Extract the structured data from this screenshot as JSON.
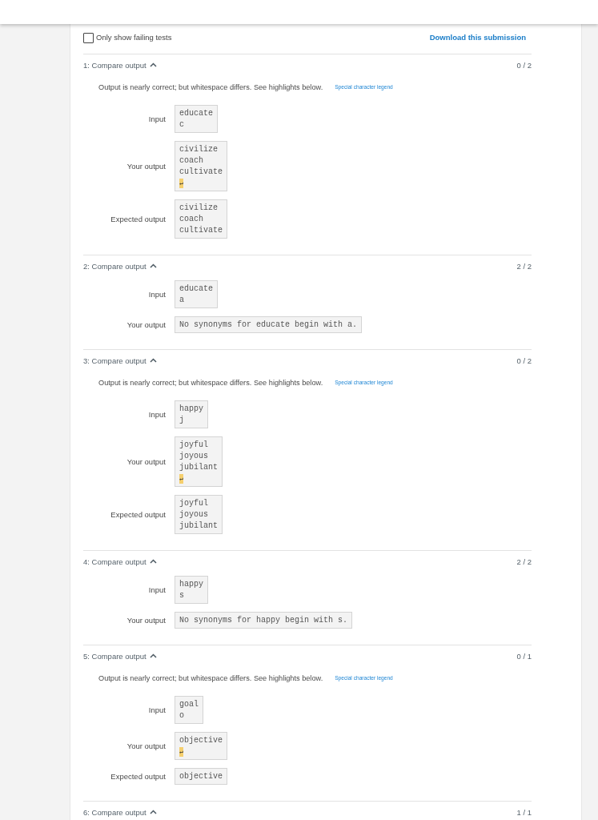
{
  "filter": {
    "label": "Only show failing tests",
    "checked": false
  },
  "download_link": "Download this submission",
  "tests": [
    {
      "title": "1: Compare output",
      "expanded": true,
      "score": "0 / 2",
      "message": {
        "text": "Output is nearly correct; but whitespace differs. See highlights below.",
        "link": "Special character legend"
      },
      "rows": [
        {
          "label": "Input",
          "lines": [
            "educate",
            "c"
          ]
        },
        {
          "label": "Your output",
          "lines": [
            "civilize",
            "coach",
            "cultivate"
          ],
          "marker": "↵"
        },
        {
          "label": "Expected output",
          "lines": [
            "civilize",
            "coach",
            "cultivate"
          ]
        }
      ]
    },
    {
      "title": "2: Compare output",
      "expanded": true,
      "score": "2 / 2",
      "rows": [
        {
          "label": "Input",
          "lines": [
            "educate",
            "a"
          ]
        },
        {
          "label": "Your output",
          "lines": [
            "No synonyms for educate begin with a."
          ]
        }
      ]
    },
    {
      "title": "3: Compare output",
      "expanded": true,
      "score": "0 / 2",
      "message": {
        "text": "Output is nearly correct; but whitespace differs. See highlights below.",
        "link": "Special character legend"
      },
      "rows": [
        {
          "label": "Input",
          "lines": [
            "happy",
            "j"
          ]
        },
        {
          "label": "Your output",
          "lines": [
            "joyful",
            "joyous",
            "jubilant"
          ],
          "marker": "↵"
        },
        {
          "label": "Expected output",
          "lines": [
            "joyful",
            "joyous",
            "jubilant"
          ]
        }
      ]
    },
    {
      "title": "4: Compare output",
      "expanded": true,
      "score": "2 / 2",
      "rows": [
        {
          "label": "Input",
          "lines": [
            "happy",
            "s"
          ]
        },
        {
          "label": "Your output",
          "lines": [
            "No synonyms for happy begin with s."
          ]
        }
      ]
    },
    {
      "title": "5: Compare output",
      "expanded": true,
      "score": "0 / 1",
      "message": {
        "text": "Output is nearly correct; but whitespace differs. See highlights below.",
        "link": "Special character legend"
      },
      "rows": [
        {
          "label": "Input",
          "lines": [
            "goal",
            "o"
          ]
        },
        {
          "label": "Your output",
          "lines": [
            "objective"
          ],
          "marker": "↵"
        },
        {
          "label": "Expected output",
          "lines": [
            "objective"
          ]
        }
      ]
    },
    {
      "title": "6: Compare output",
      "expanded": true,
      "score": "1 / 1"
    }
  ]
}
